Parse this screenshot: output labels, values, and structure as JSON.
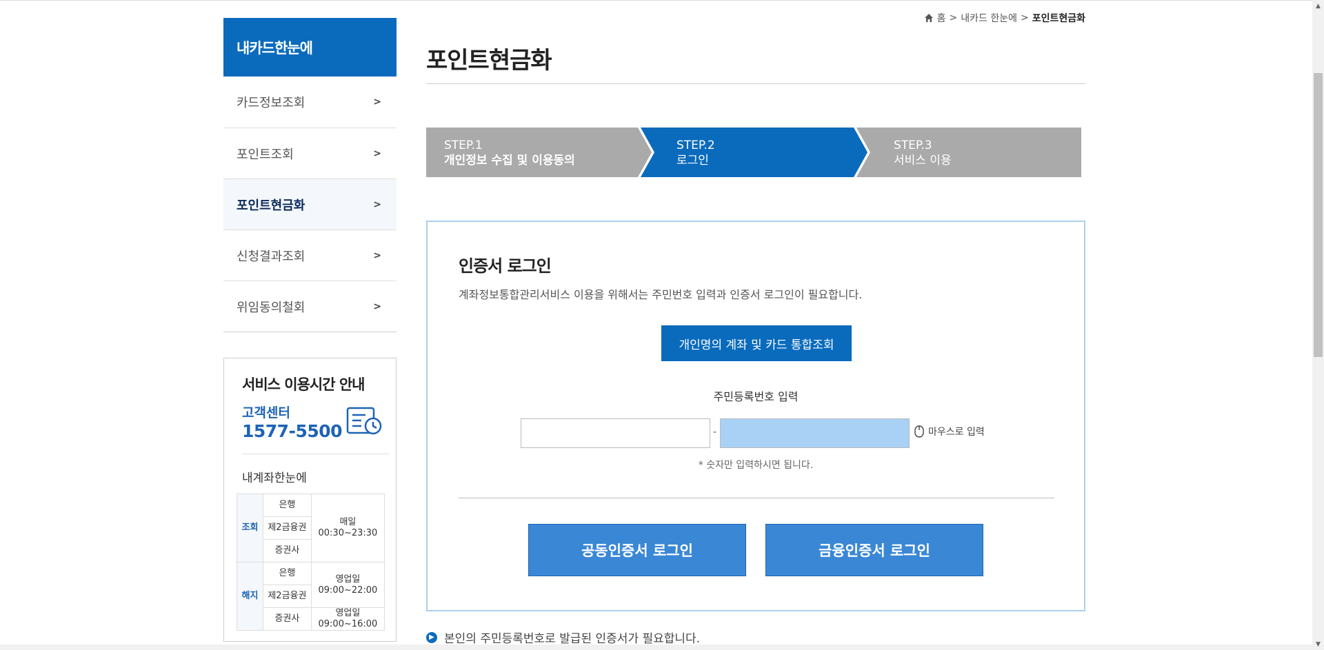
{
  "breadcrumb": {
    "home": "홈",
    "level1": "내카드 한눈에",
    "current": "포인트현금화",
    "sep": ">"
  },
  "sidebar": {
    "title": "내카드한눈에",
    "items": [
      {
        "label": "카드정보조회"
      },
      {
        "label": "포인트조회"
      },
      {
        "label": "포인트현금화"
      },
      {
        "label": "신청결과조회"
      },
      {
        "label": "위임동의철회"
      }
    ],
    "chevron": ">"
  },
  "info": {
    "title": "서비스 이용시간 안내",
    "cc_label": "고객센터",
    "cc_phone": "1577-5500",
    "subtitle": "내계좌한눈에",
    "query_label": "조회",
    "cancel_label": "해지",
    "bank": "은행",
    "second": "제2금융권",
    "securities": "증권사",
    "query_time_1": "매일",
    "query_time_2": "00:30~23:30",
    "cancel_time_a1": "영업일",
    "cancel_time_a2": "09:00~22:00",
    "cancel_time_b1": "영업일",
    "cancel_time_b2": "09:00~16:00"
  },
  "page": {
    "title": "포인트현금화"
  },
  "steps": [
    {
      "num": "STEP.1",
      "name": "개인정보 수집 및 이용동의"
    },
    {
      "num": "STEP.2",
      "name": "로그인"
    },
    {
      "num": "STEP.3",
      "name": "서비스 이용"
    }
  ],
  "colors": {
    "primary": "#0a6bbd",
    "step_inactive": "#aaaaaa",
    "ssn_back": "#a9d0f5",
    "box_border": "#a8d0ef"
  },
  "login": {
    "title": "인증서 로그인",
    "desc": "계좌정보통합관리서비스 이용을 위해서는 주민번호 입력과 인증서 로그인이 필요합니다.",
    "integrated_button": "개인명의 계좌 및 카드 통합조회",
    "ssn_label": "주민등록번호 입력",
    "ssn_front_value": "",
    "ssn_dash": "-",
    "ssn_back_value": "",
    "mouse_input": "마우스로 입력",
    "ssn_note": "* 숫자만 입력하시면 됩니다.",
    "joint_cert_button": "공동인증서 로그인",
    "financial_cert_button": "금융인증서 로그인"
  },
  "notice": {
    "text": "본인의 주민등록번호로 발급된 인증서가 필요합니다."
  }
}
